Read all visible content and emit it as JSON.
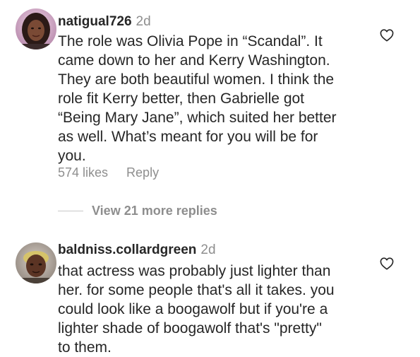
{
  "comments": [
    {
      "username": "natigual726",
      "time": "2d",
      "text": "The role was Olivia Pope in “Scandal”. It\ncame down to her and Kerry Washington.\nThey are both beautiful women. I think the\nrole fit Kerry better, then Gabrielle got\n“Being Mary Jane”, which suited her better\nas well. What’s meant for you will be for\nyou.",
      "likes": "574 likes",
      "reply_label": "Reply",
      "avatar_icon": "profile-photo",
      "like_icon": "heart-outline-icon"
    },
    {
      "username": "baldniss.collardgreen",
      "time": "2d",
      "text": "that actress was probably just lighter than\nher. for some people that's all it takes. you\ncould look like a boogawolf but if you're a\nlighter shade of boogawolf that's \"pretty\"\nto them.",
      "avatar_icon": "profile-photo",
      "like_icon": "heart-outline-icon"
    }
  ],
  "view_more_replies": "View 21 more replies",
  "colors": {
    "text_primary": "#262626",
    "text_secondary": "#8e8e8e",
    "divider": "#c7c7c7",
    "background": "#ffffff"
  }
}
